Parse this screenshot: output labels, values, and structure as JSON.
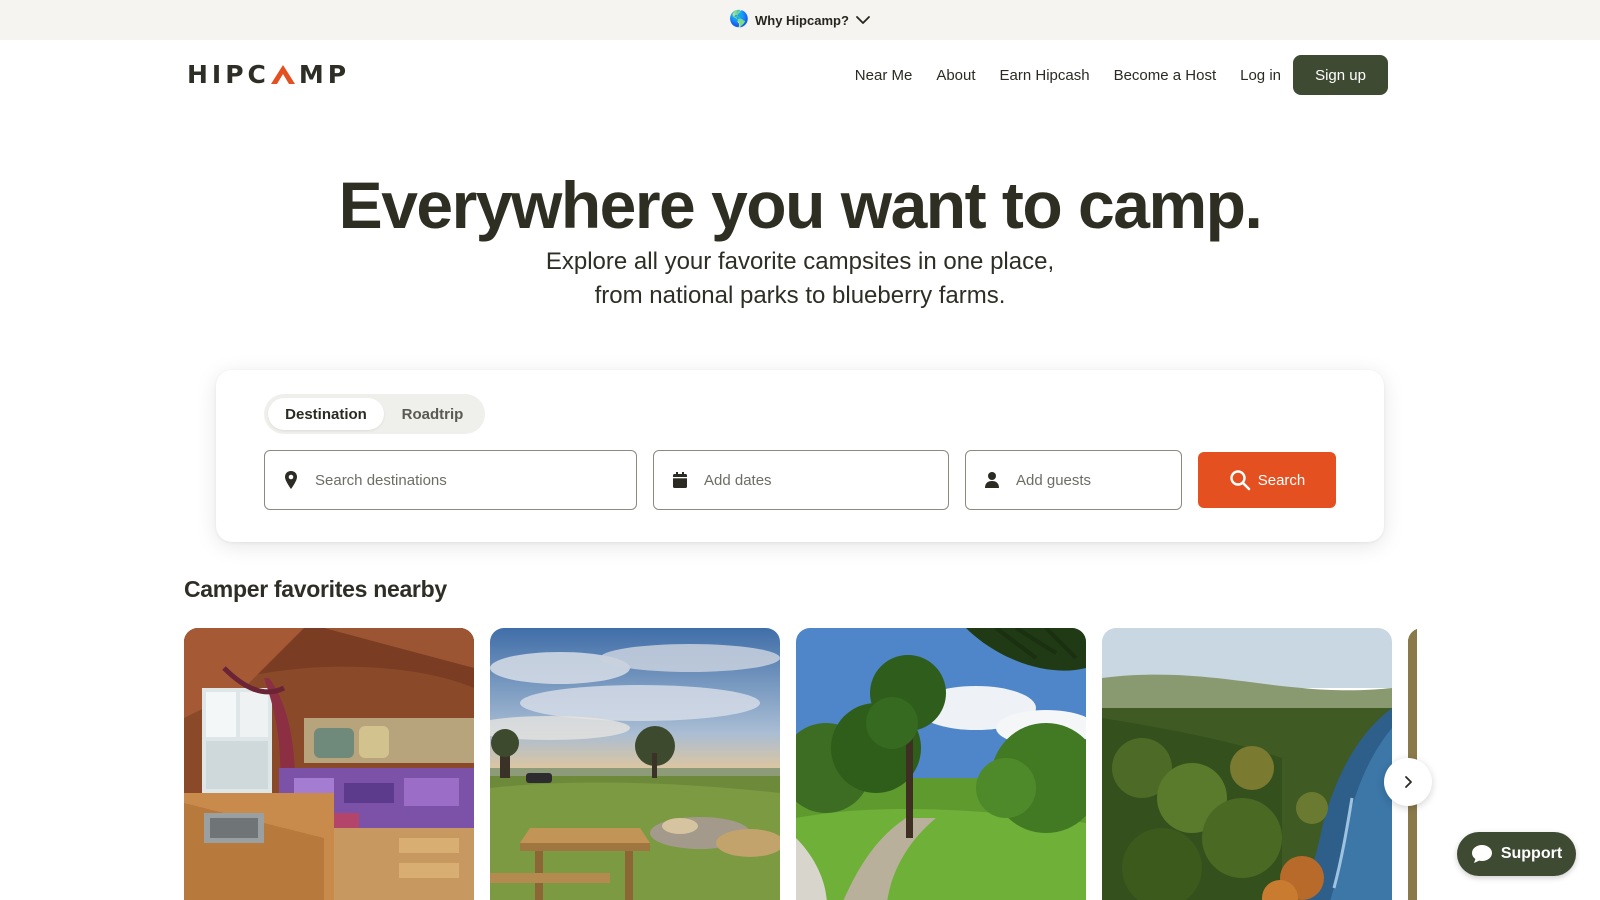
{
  "announcement": {
    "globe_icon": "globe-icon",
    "label": "Why Hipcamp?",
    "chevron_icon": "chevron-down-icon"
  },
  "nav": {
    "logo_before": "HIPC",
    "logo_after": "MP",
    "links": [
      "Near Me",
      "About",
      "Earn Hipcash",
      "Become a Host",
      "Log in"
    ],
    "signup": "Sign up"
  },
  "hero": {
    "title": "Everywhere you want to camp.",
    "subtitle_line1": "Explore all your favorite campsites in one place,",
    "subtitle_line2": "from national parks to blueberry farms."
  },
  "search": {
    "tabs": [
      {
        "label": "Destination",
        "active": true
      },
      {
        "label": "Roadtrip",
        "active": false
      }
    ],
    "destination_placeholder": "Search destinations",
    "dates_placeholder": "Add dates",
    "guests_placeholder": "Add guests",
    "button": "Search"
  },
  "favorites": {
    "title": "Camper favorites nearby",
    "cards": [
      {
        "image": "cabin-interior-photo"
      },
      {
        "image": "hilltop-picnic-photo"
      },
      {
        "image": "forest-meadow-photo"
      },
      {
        "image": "river-valley-photo"
      },
      {
        "image": "partial-card-photo"
      }
    ],
    "next_icon": "chevron-right-icon"
  },
  "support": {
    "label": "Support",
    "icon": "chat-bubble-icon"
  },
  "colors": {
    "brand_green": "#3f4a33",
    "search_orange": "#e4501f",
    "banner_bg": "#f5f4f0",
    "logo_accent": "#e4501f"
  }
}
